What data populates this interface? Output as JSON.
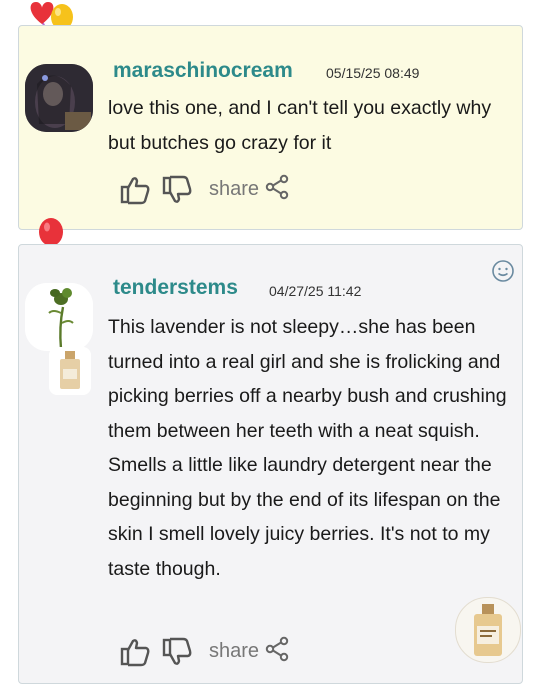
{
  "comments": [
    {
      "username": "maraschinocream",
      "timestamp": "05/15/25 08:49",
      "text": "love this one, and I can't tell you exactly why but butches go crazy for it",
      "share_label": "share"
    },
    {
      "username": "tenderstems",
      "timestamp": "04/27/25 11:42",
      "text": "This lavender is not sleepy…she has been turned into a real girl and she is frolicking and picking berries off a nearby bush and crushing them between her teeth with a neat squish. Smells a little like laundry detergent near the beginning but by the end of its lifespan on the skin I smell lovely juicy berries. It's not to my taste though.",
      "share_label": "share"
    }
  ],
  "colors": {
    "username": "#2d8a8a",
    "card1_bg": "#fcfbe2",
    "card2_bg": "#f4f4f6",
    "balloon_red": "#e8323a",
    "balloon_yellow": "#f6c21b"
  }
}
